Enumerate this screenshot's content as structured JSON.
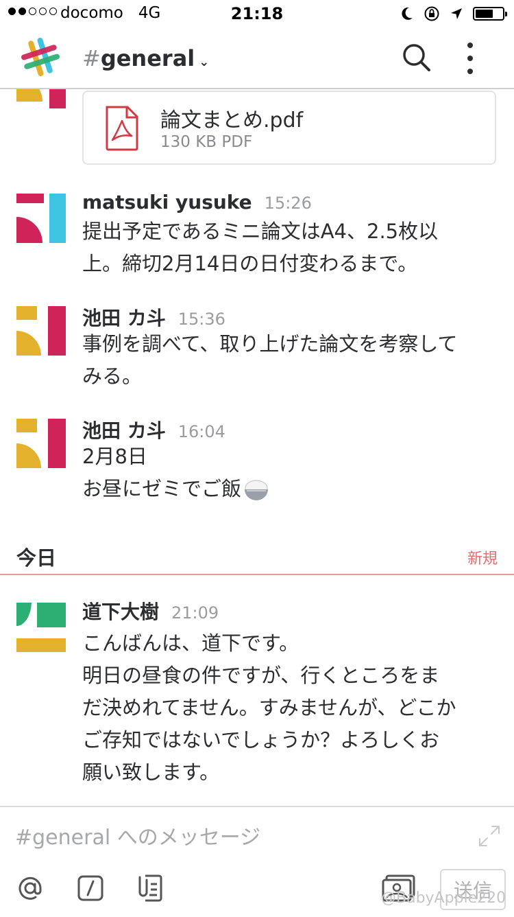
{
  "status_bar": {
    "carrier": "docomo",
    "network": "4G",
    "time": "21:18",
    "signal_strength": 2,
    "signal_max": 5,
    "battery_level": 0.6,
    "icons": [
      "moon-icon",
      "orientation-lock-icon",
      "location-arrow-icon",
      "battery-icon"
    ]
  },
  "header": {
    "hash": "#",
    "channel": "general",
    "dropdown_glyph": "⌄",
    "icons": [
      "slack-logo",
      "search-icon",
      "more-vertical-icon"
    ]
  },
  "colors": {
    "text": "#2c2d30",
    "muted": "#9b9ca0",
    "new_divider": "#e0706e",
    "pdf_red": "#d13943",
    "slack_yellow": "#e3b12c",
    "slack_red": "#d0235a",
    "slack_blue": "#3ec4e0",
    "slack_green": "#2dae72"
  },
  "file": {
    "name": "論文まとめ.pdf",
    "meta": "130 KB PDF",
    "icon": "pdf-file-icon"
  },
  "messages": [
    {
      "sender": "matsuki yusuke",
      "time": "15:26",
      "lines": [
        "提出予定であるミニ論文はA4、2.5枚以",
        "上。締切2月14日の日付変わるまで。"
      ]
    },
    {
      "sender": "池田 カ斗",
      "time": "15:36",
      "lines": [
        "事例を調べて、取り上げた論文を考察して",
        "みる。"
      ]
    },
    {
      "sender": "池田 カ斗",
      "time": "16:04",
      "lines": [
        "2月8日",
        "お昼にゼミでご飯"
      ],
      "emoji": "rice-bowl-icon"
    }
  ],
  "divider": {
    "label": "今日",
    "new_label": "新規"
  },
  "today_message": {
    "sender": "道下大樹",
    "time": "21:09",
    "lines": [
      "こんばんは、道下です。",
      "明日の昼食の件ですが、行くところをま",
      "だ決めれてません。すみませんが、どこか",
      "ご存知ではないでしょうか？よろしくお",
      "願い致します。"
    ]
  },
  "composer": {
    "placeholder": "#general へのメッセージ",
    "value": "",
    "send_label": "送信",
    "tools": [
      "mention-icon",
      "slash-command-icon",
      "file-attach-icon",
      "image-icon",
      "expand-icon"
    ]
  },
  "watermark": "@BabyApple220"
}
